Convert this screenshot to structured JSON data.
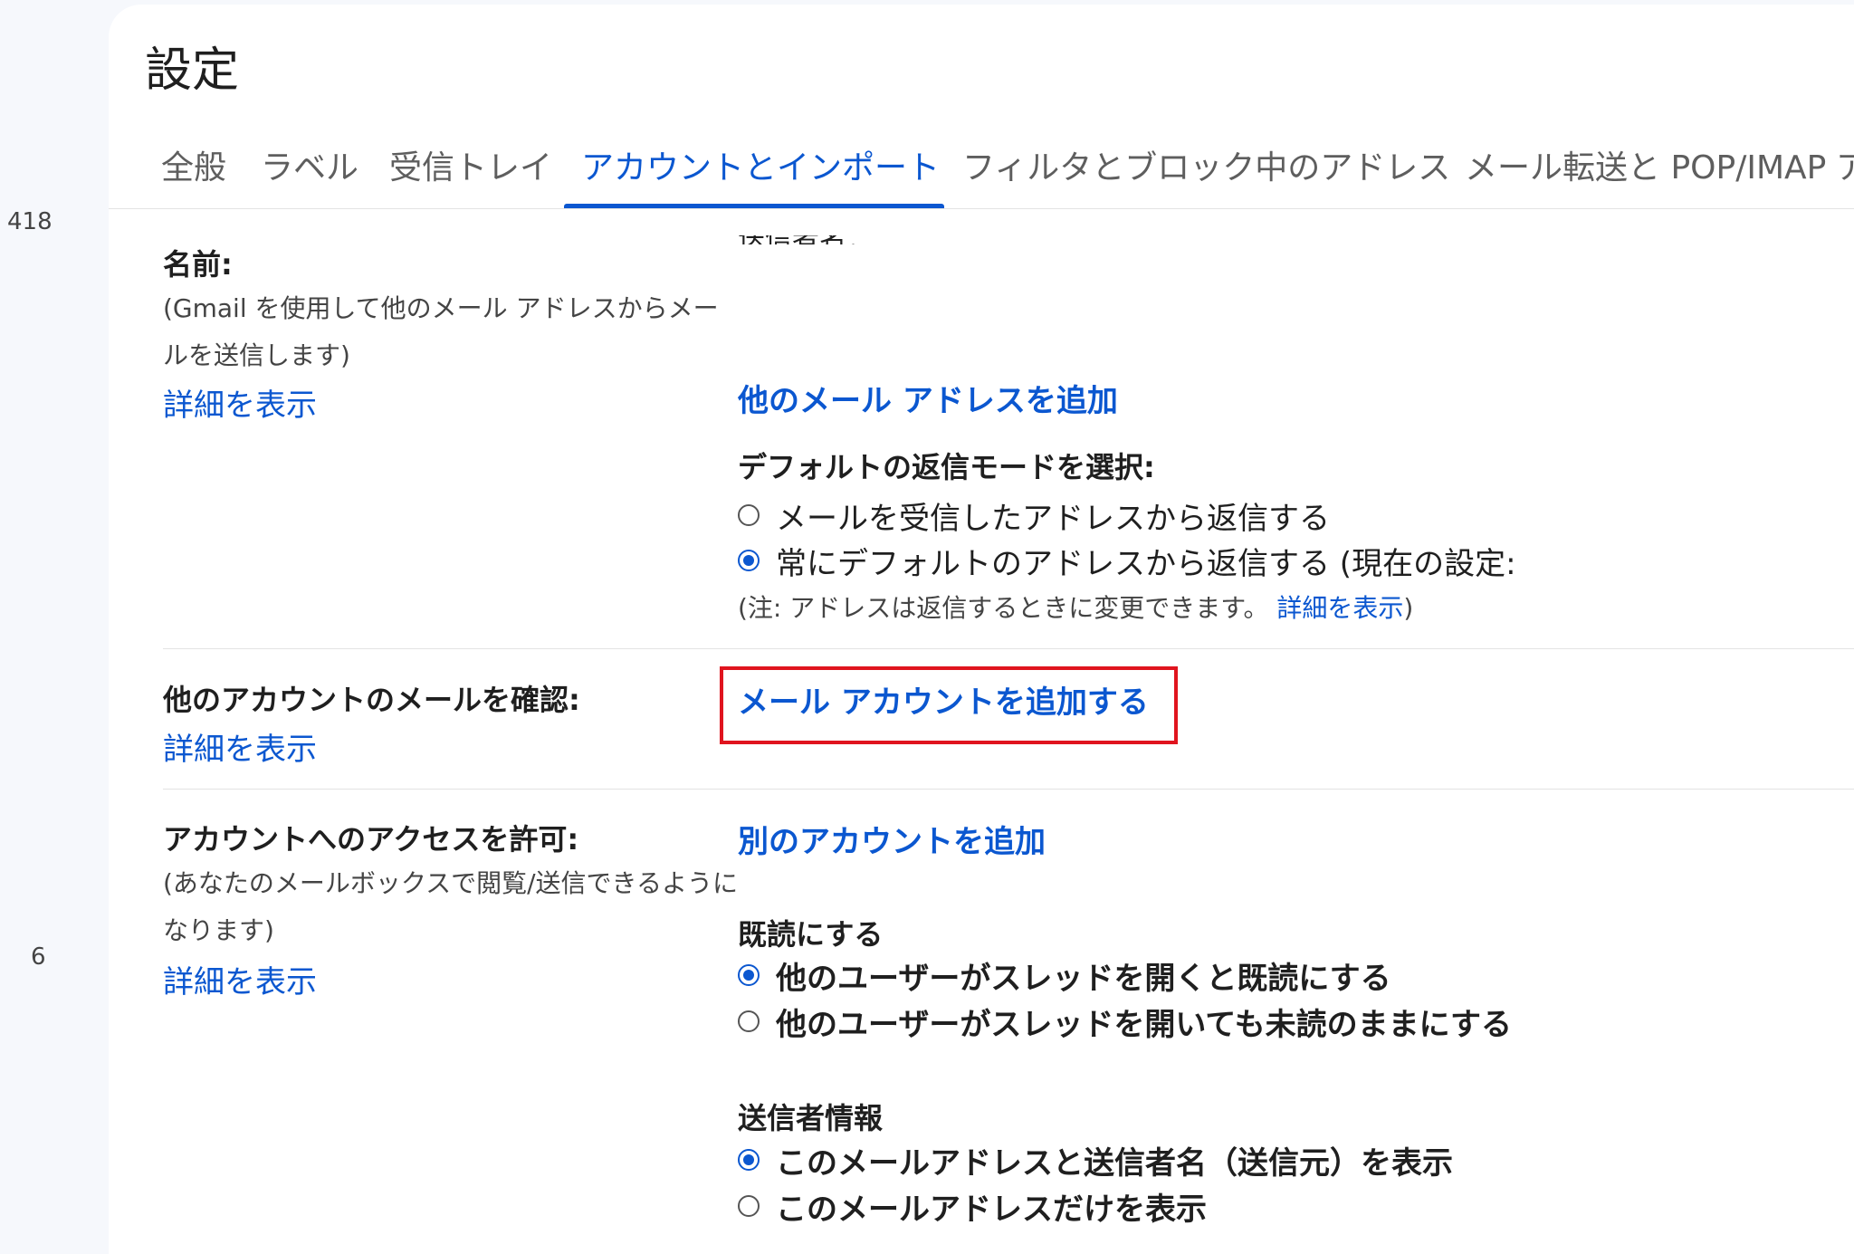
{
  "rail": {
    "count_1": "418",
    "count_2": "6"
  },
  "page": {
    "title": "設定"
  },
  "tabs": [
    {
      "label": "全般"
    },
    {
      "label": "ラベル"
    },
    {
      "label": "受信トレイ"
    },
    {
      "label": "アカウントとインポート"
    },
    {
      "label": "フィルタとブロック中のアドレス"
    },
    {
      "label": "メール転送と POP/IMAP"
    },
    {
      "label": "ア"
    }
  ],
  "cut_text": "送信者名：",
  "sections": {
    "name": {
      "title": "名前:",
      "desc": "(Gmail を使用して他のメール アドレスからメールを送信します)",
      "more_link": "詳細を表示",
      "add_address_link": "他のメール アドレスを追加",
      "reply_heading": "デフォルトの返信モードを選択:",
      "reply_option_1": "メールを受信したアドレスから返信する",
      "reply_option_2": "常にデフォルトのアドレスから返信する (現在の設定:",
      "note_prefix": "(注: アドレスは返信するときに変更できます。",
      "note_link": "詳細を表示",
      "note_suffix": ")"
    },
    "check_mail": {
      "title": "他のアカウントのメールを確認:",
      "more_link": "詳細を表示",
      "add_account_link": "メール アカウントを追加する"
    },
    "grant_access": {
      "title": "アカウントへのアクセスを許可:",
      "desc": "(あなたのメールボックスで閲覧/送信できるようになります)",
      "more_link": "詳細を表示",
      "add_other_link": "別のアカウントを追加",
      "read_heading": "既読にする",
      "read_option_1": "他のユーザーがスレッドを開くと既読にする",
      "read_option_2": "他のユーザーがスレッドを開いても未読のままにする",
      "sender_heading": "送信者情報",
      "sender_option_1": "このメールアドレスと送信者名（送信元）を表示",
      "sender_option_2": "このメールアドレスだけを表示"
    }
  },
  "colors": {
    "accent": "#0b57d0",
    "highlight": "#e0141e"
  }
}
